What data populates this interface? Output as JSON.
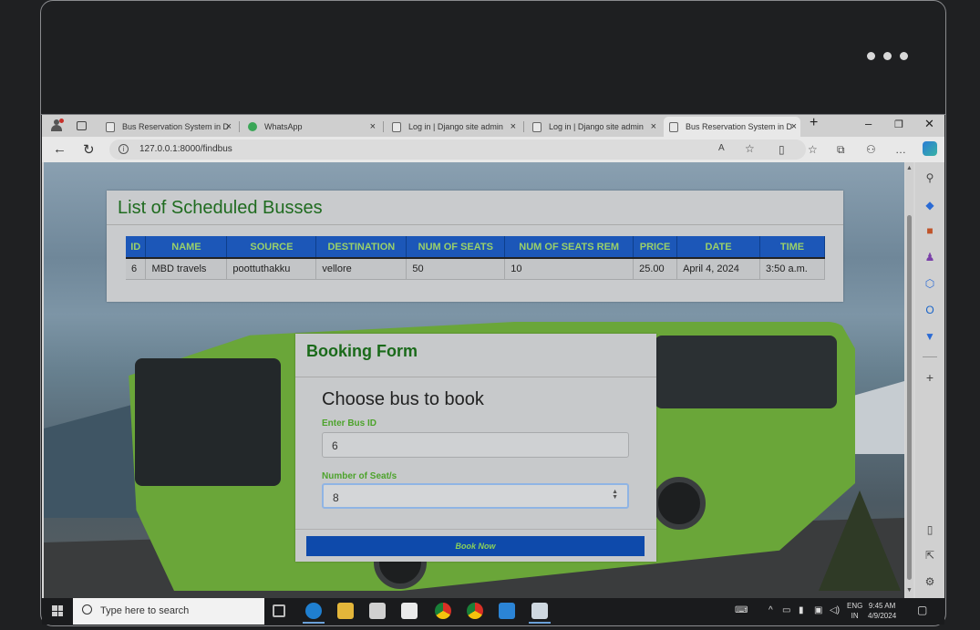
{
  "browser": {
    "tabs": [
      {
        "title": "Bus Reservation System in D"
      },
      {
        "title": "WhatsApp"
      },
      {
        "title": "Log in | Django site admin"
      },
      {
        "title": "Log in | Django site admin"
      },
      {
        "title": "Bus Reservation System in D"
      }
    ],
    "new_tab": "+",
    "url": "127.0.0.1:8000/findbus"
  },
  "page": {
    "list_title": "List of Scheduled Busses",
    "table": {
      "headers": [
        "ID",
        "NAME",
        "SOURCE",
        "DESTINATION",
        "NUM OF SEATS",
        "NUM OF SEATS REM",
        "PRICE",
        "DATE",
        "TIME"
      ],
      "rows": [
        [
          "6",
          "MBD travels",
          "poottuthakku",
          "vellore",
          "50",
          "10",
          "25.00",
          "April 4, 2024",
          "3:50 a.m."
        ]
      ]
    },
    "form": {
      "title": "Booking Form",
      "heading": "Choose bus to book",
      "bus_id_label": "Enter Bus ID",
      "bus_id_value": "6",
      "seats_label": "Number of Seat/s",
      "seats_value": "8",
      "submit_label": "Book Now"
    }
  },
  "taskbar": {
    "search_placeholder": "Type here to search",
    "language": "ENG",
    "region": "IN",
    "time": "9:45 AM",
    "date": "4/9/2024"
  },
  "colors": {
    "table_header_bg": "#1c57b8",
    "table_header_text": "#9ad06a",
    "title_green": "#1f6b1f",
    "button_bg": "#0e4aab"
  }
}
